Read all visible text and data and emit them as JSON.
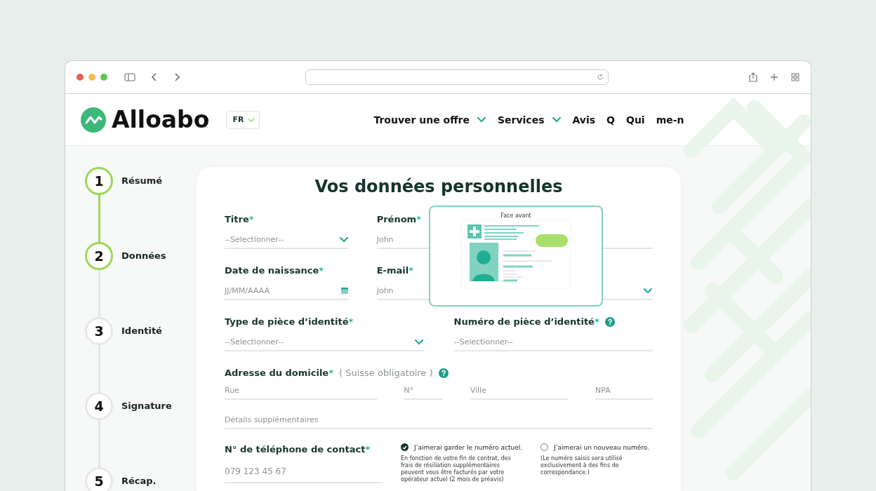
{
  "header": {
    "logo": "Alloabo",
    "language": "FR",
    "nav": [
      {
        "label": "Trouver une offre",
        "dropdown": true
      },
      {
        "label": "Services",
        "dropdown": true
      },
      {
        "label": "Avis",
        "dropdown": false
      },
      {
        "label": "Q",
        "dropdown": false
      },
      {
        "label": "Qui",
        "dropdown": false
      },
      {
        "label": "me-n",
        "dropdown": false
      }
    ]
  },
  "steps": [
    {
      "number": "1",
      "label": "Résumé",
      "completed": true
    },
    {
      "number": "2",
      "label": "Données",
      "completed": true
    },
    {
      "number": "3",
      "label": "Identité",
      "completed": false
    },
    {
      "number": "4",
      "label": "Signature",
      "completed": false
    },
    {
      "number": "5",
      "label": "Récap.",
      "completed": false
    }
  ],
  "form": {
    "title": "Vos données personnelles",
    "row_1": [
      {
        "label": "Titre",
        "required": "*",
        "kind": "select",
        "placeholder": "--Selectionner--"
      },
      {
        "label": "Prénom",
        "required": "*",
        "kind": "text",
        "placeholder": "John"
      },
      {
        "kind": "text"
      }
    ],
    "row_2": [
      {
        "label": "Date de naissance",
        "required": "*",
        "kind": "date",
        "placeholder": "JJ/MM/AAAA"
      },
      {
        "label": "E-mail",
        "required": "*",
        "kind": "text",
        "placeholder": "John"
      },
      {
        "kind": "select"
      }
    ],
    "row_3": [
      {
        "label": "Type de pièce d’identité",
        "required": "*",
        "kind": "select",
        "placeholder": "--Selectionner--",
        "help": false
      },
      {
        "label": "Numéro de pièce d’identité",
        "required": "*",
        "kind": "text",
        "placeholder": "--Selectionner--",
        "help": true
      }
    ],
    "address": {
      "label": "Adresse du domicile",
      "required": "*",
      "note": "( Suisse obligatoire )",
      "fields": [
        "Rue",
        "N°",
        "Ville",
        "NPA"
      ],
      "details": "Détails supplémentaires"
    },
    "phone": {
      "label": "N° de téléphone de contact",
      "required": "*",
      "placeholder": "079 123 45 67",
      "options": [
        {
          "label": "J’aimerai garder le numéro actuel.",
          "note": "En fonction de votre fin de contrat, des frais de résiliation supplémentaires peuvent vous être facturés par votre opérateur actuel (2 mois de préavis)",
          "selected": true
        },
        {
          "label": "J’aimerai un nouveau numéro.",
          "note": "(Le numéro saisis sera utilisé exclusivement à des fins de correspondance.)",
          "selected": false
        }
      ]
    },
    "id_popup": {
      "caption": "Face avant"
    }
  }
}
